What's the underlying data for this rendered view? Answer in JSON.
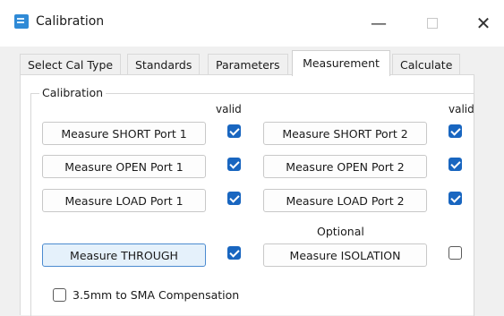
{
  "window": {
    "title": "Calibration",
    "minimize_glyph": "—",
    "close_glyph": "✕"
  },
  "tabs": [
    {
      "label": "Select Cal Type",
      "active": false
    },
    {
      "label": "Standards",
      "active": false
    },
    {
      "label": "Parameters",
      "active": false
    },
    {
      "label": "Measurement",
      "active": true
    },
    {
      "label": "Calculate",
      "active": false
    }
  ],
  "calibration": {
    "group_label": "Calibration",
    "valid_label": "valid",
    "optional_label": "Optional",
    "port1": [
      {
        "label": "Measure SHORT Port 1",
        "valid": true
      },
      {
        "label": "Measure OPEN Port 1",
        "valid": true
      },
      {
        "label": "Measure LOAD Port 1",
        "valid": true
      }
    ],
    "port2": [
      {
        "label": "Measure SHORT Port 2",
        "valid": true
      },
      {
        "label": "Measure OPEN Port 2",
        "valid": true
      },
      {
        "label": "Measure LOAD Port 2",
        "valid": true
      }
    ],
    "through": {
      "label": "Measure THROUGH",
      "valid": true
    },
    "isolation": {
      "label": "Measure ISOLATION",
      "valid": false
    },
    "compensation": {
      "label": "3.5mm to SMA Compensation",
      "checked": false
    }
  },
  "colors": {
    "accent": "#1966c0",
    "primary_button_bg": "#e5f1fb",
    "primary_button_border": "#4b8bd0"
  }
}
